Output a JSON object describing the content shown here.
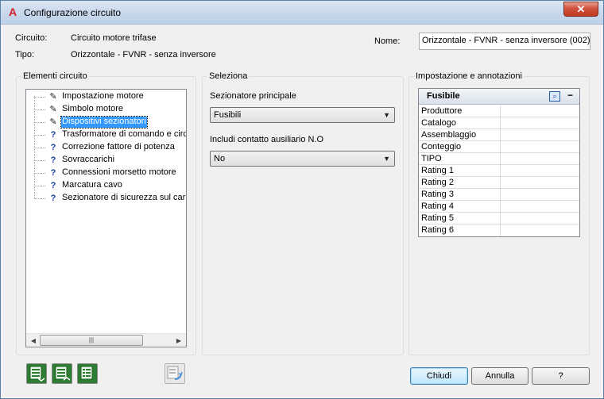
{
  "window": {
    "title": "Configurazione circuito",
    "close_glyph": "✕",
    "app_icon": "A"
  },
  "header": {
    "circuito_label": "Circuito:",
    "circuito_value": "Circuito motore trifase",
    "tipo_label": "Tipo:",
    "tipo_value": "Orizzontale - FVNR - senza inversore",
    "nome_label": "Nome:",
    "nome_value": "Orizzontale - FVNR - senza inversore (002)"
  },
  "elementi": {
    "title": "Elementi circuito",
    "items": [
      {
        "label": "Impostazione motore",
        "icon": "pencil-icon"
      },
      {
        "label": "Simbolo motore",
        "icon": "pencil-icon"
      },
      {
        "label": "Dispositivi sezionatori",
        "icon": "pencil-icon",
        "selected": true
      },
      {
        "label": "Trasformatore di comando e circuito",
        "icon": "question-icon"
      },
      {
        "label": "Correzione fattore di potenza",
        "icon": "question-icon"
      },
      {
        "label": "Sovraccarichi",
        "icon": "question-icon"
      },
      {
        "label": "Connessioni morsetto motore",
        "icon": "question-icon"
      },
      {
        "label": "Marcatura cavo",
        "icon": "question-icon"
      },
      {
        "label": "Sezionatore di sicurezza sul carico",
        "icon": "question-icon"
      }
    ]
  },
  "seleziona": {
    "title": "Seleziona",
    "sezionatore_label": "Sezionatore principale",
    "sezionatore_value": "Fusibili",
    "contatto_label": "Includi contatto ausiliario N.O",
    "contatto_value": "No"
  },
  "impostazione": {
    "title": "Impostazione e annotazioni",
    "grid_title": "Fusibile",
    "min_glyph": "−",
    "rows": [
      "Produttore",
      "Catalogo",
      "Assemblaggio",
      "Conteggio",
      "TIPO",
      "Rating 1",
      "Rating 2",
      "Rating 3",
      "Rating 4",
      "Rating 5",
      "Rating 6"
    ]
  },
  "buttons": {
    "chiudi": "Chiudi",
    "annulla": "Annulla",
    "help": "?"
  },
  "colors": {
    "selection": "#3399ff",
    "question": "#1a3ea0",
    "close": "#c23a22"
  }
}
